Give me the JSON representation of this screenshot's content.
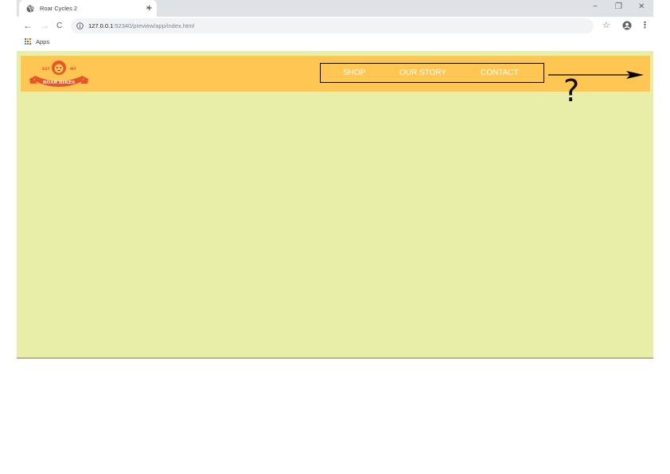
{
  "browser": {
    "tab": {
      "title": "Roar Cycles 2",
      "close_symbol": "×",
      "favicon": "globe-icon"
    },
    "new_tab_symbol": "+",
    "window_controls": {
      "minimize": "−",
      "restore": "❐",
      "close": "✕"
    },
    "nav": {
      "back": "←",
      "forward": "→",
      "reload": "C"
    },
    "address": {
      "host": "127.0.0.1",
      "path": ":52340/preview/app/index.html"
    },
    "bookmark_star": "☆",
    "menu_symbol": "⋮",
    "bookmarks_bar": {
      "apps_label": "Apps"
    },
    "colors": {
      "tabstrip": "#dee1e6",
      "omnibox": "#f1f3f4"
    }
  },
  "page": {
    "colors": {
      "background": "#e8eea8",
      "header": "#ffc652",
      "nav_text": "#ffffff",
      "logo_accent": "#e9542a"
    },
    "logo": {
      "top_left": "EST",
      "top_right": "MY",
      "banner_text": "ROAR BIKES"
    },
    "nav_links": [
      "SHOP",
      "OUR STORY",
      "CONTACT"
    ]
  },
  "annotation": {
    "question": "?"
  }
}
